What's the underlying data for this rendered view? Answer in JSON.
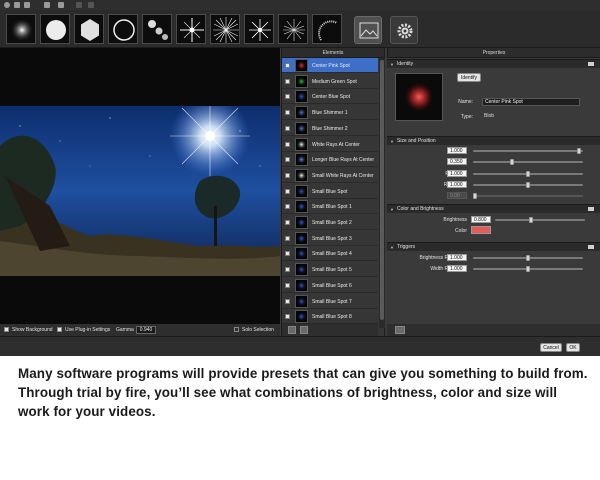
{
  "elements_panel": {
    "title": "Elements",
    "items": [
      {
        "label": "Center Pink Spot",
        "selected": true,
        "color": "#e23a3a"
      },
      {
        "label": "Medium Green Spot",
        "selected": false,
        "color": "#3ac24a"
      },
      {
        "label": "Center Blue Spot",
        "selected": false,
        "color": "#3a5ae2"
      },
      {
        "label": "Blue Shimmer 1",
        "selected": false,
        "color": "#5a7ae2"
      },
      {
        "label": "Blue Shimmer 2",
        "selected": false,
        "color": "#5a7ae2"
      },
      {
        "label": "White Rays At Center",
        "selected": false,
        "color": "#ffffff"
      },
      {
        "label": "Longer Blue Rays At Center",
        "selected": false,
        "color": "#6a8aff"
      },
      {
        "label": "Small White Rays At Center",
        "selected": false,
        "color": "#ffffff"
      },
      {
        "label": "Small Blue Spot",
        "selected": false,
        "color": "#3a5ae2"
      },
      {
        "label": "Small Blue Spot 1",
        "selected": false,
        "color": "#3a5ae2"
      },
      {
        "label": "Small Blue Spot 2",
        "selected": false,
        "color": "#3a5ae2"
      },
      {
        "label": "Small Blue Spot 3",
        "selected": false,
        "color": "#3a5ae2"
      },
      {
        "label": "Small Blue Spot 4",
        "selected": false,
        "color": "#3a5ae2"
      },
      {
        "label": "Small Blue Spot 5",
        "selected": false,
        "color": "#3a5ae2"
      },
      {
        "label": "Small Blue Spot 6",
        "selected": false,
        "color": "#3a5ae2"
      },
      {
        "label": "Small Blue Spot 7",
        "selected": false,
        "color": "#3a5ae2"
      },
      {
        "label": "Small Blue Spot 8",
        "selected": false,
        "color": "#3a5ae2"
      }
    ]
  },
  "properties_panel": {
    "title": "Properties",
    "identity": {
      "heading": "Identity",
      "identify_label": "Identify",
      "name_label": "Name:",
      "name_value": "Center Pink Spot",
      "type_label": "Type:",
      "type_value": "Blob"
    },
    "size_position": {
      "heading": "Size and Position",
      "rows": [
        {
          "label": "Position",
          "value": "1.000",
          "slider": 0.98,
          "disabled": false
        },
        {
          "label": "Size",
          "value": "0.350",
          "slider": 0.35,
          "disabled": false
        },
        {
          "label": "Rel Width",
          "value": "1.000",
          "slider": 0.5,
          "disabled": false
        },
        {
          "label": "Rel Height",
          "value": "1.000",
          "slider": 0.5,
          "disabled": false
        },
        {
          "label": "Angle",
          "value": "0.00",
          "slider": 0.0,
          "disabled": true
        }
      ]
    },
    "color_brightness": {
      "heading": "Color and Brightness",
      "brightness_label": "Brightness",
      "brightness_value": "0.800",
      "brightness_slider": 0.4,
      "color_label": "Color",
      "color_value": "#e45a5a"
    },
    "triggers": {
      "heading": "Triggers",
      "rows": [
        {
          "label": "Brightness Response",
          "value": "1.000",
          "slider": 0.5
        },
        {
          "label": "Width Response",
          "value": "1.000",
          "slider": 0.5
        }
      ]
    }
  },
  "preview_bar": {
    "show_background": "Show Background",
    "use_plugin_settings": "Use Plug-in Settings",
    "gamma_label": "Gamma",
    "gamma_value": "0.940",
    "solo_selection": "Solo Selection"
  },
  "footer": {
    "cancel": "Cancel",
    "ok": "OK"
  },
  "caption": "Many software programs will provide presets that can give you something to build from. Through trial by fire, you’ll see what combinations of brightness, color and size will work for your videos."
}
